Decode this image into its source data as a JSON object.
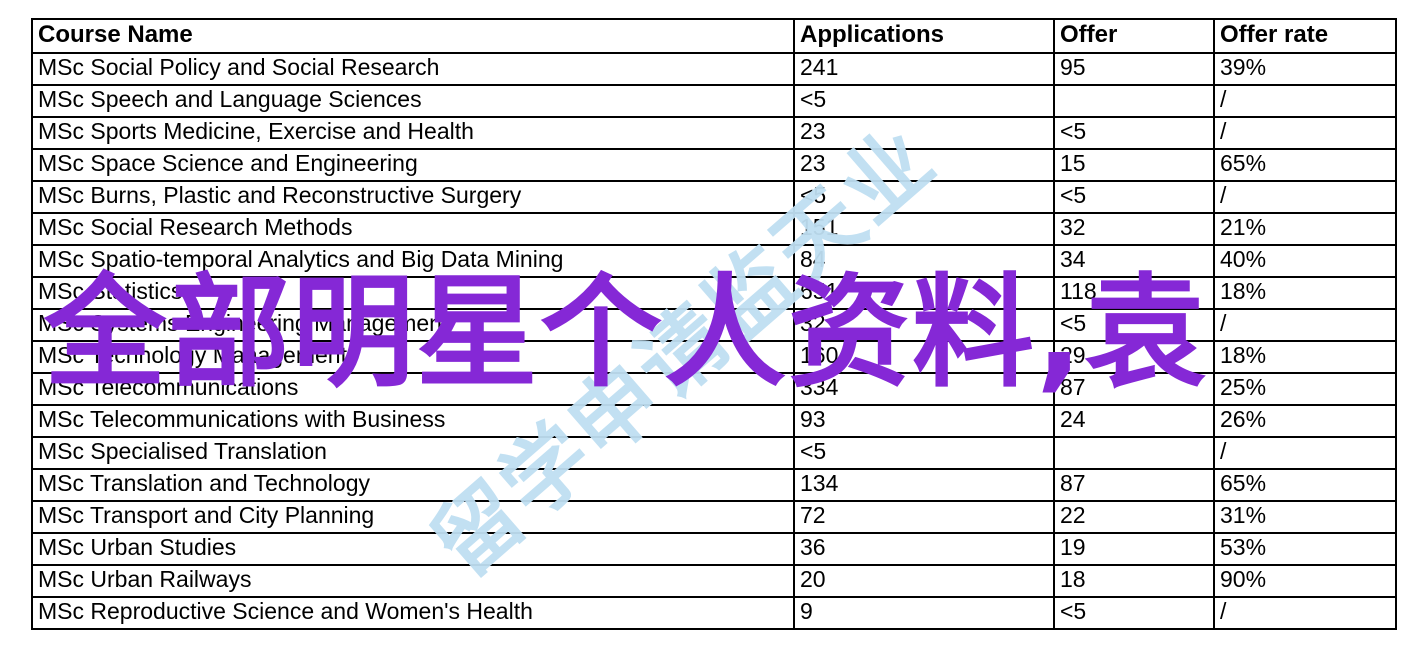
{
  "table": {
    "columns": [
      "Course Name",
      "Applications",
      "Offer",
      "Offer rate"
    ],
    "rows": [
      {
        "course": "MSc Social Policy and Social Research",
        "applications": "241",
        "offer": "95",
        "rate": "39%"
      },
      {
        "course": "MSc Speech and Language Sciences",
        "applications": "<5",
        "offer": "",
        "rate": "/"
      },
      {
        "course": "MSc Sports Medicine, Exercise and Health",
        "applications": "23",
        "offer": "<5",
        "rate": "/"
      },
      {
        "course": "MSc Space Science and Engineering",
        "applications": "23",
        "offer": "15",
        "rate": "65%"
      },
      {
        "course": "MSc Burns, Plastic and Reconstructive Surgery",
        "applications": "<5",
        "offer": "<5",
        "rate": "/"
      },
      {
        "course": "MSc Social Research Methods",
        "applications": "151",
        "offer": "32",
        "rate": "21%"
      },
      {
        "course": "MSc Spatio-temporal Analytics and Big Data Mining",
        "applications": "84",
        "offer": "34",
        "rate": "40%"
      },
      {
        "course": "MSc Statistics",
        "applications": "651",
        "offer": "118",
        "rate": "18%"
      },
      {
        "course": "MSc Systems Engineering Management",
        "applications": "32",
        "offer": "<5",
        "rate": "/"
      },
      {
        "course": "MSc Technology Management",
        "applications": "160",
        "offer": "29",
        "rate": "18%"
      },
      {
        "course": "MSc Telecommunications",
        "applications": "334",
        "offer": "87",
        "rate": "25%"
      },
      {
        "course": "MSc Telecommunications with Business",
        "applications": "93",
        "offer": "24",
        "rate": "26%"
      },
      {
        "course": "MSc Specialised Translation",
        "applications": "<5",
        "offer": "",
        "rate": "/"
      },
      {
        "course": "MSc Translation and Technology",
        "applications": "134",
        "offer": "87",
        "rate": "65%"
      },
      {
        "course": "MSc Transport and City Planning",
        "applications": "72",
        "offer": "22",
        "rate": "31%"
      },
      {
        "course": "MSc Urban Studies",
        "applications": "36",
        "offer": "19",
        "rate": "53%"
      },
      {
        "course": "MSc Urban Railways",
        "applications": "20",
        "offer": "18",
        "rate": "90%"
      },
      {
        "course": "MSc Reproductive Science and Women's Health",
        "applications": "9",
        "offer": "<5",
        "rate": "/"
      }
    ]
  },
  "watermarks": {
    "purple_text": "全部明星个人资料,袁",
    "purple_color": "#8528d6",
    "blue_text": "留学申请监天业",
    "blue_color": "#bfdff2"
  }
}
